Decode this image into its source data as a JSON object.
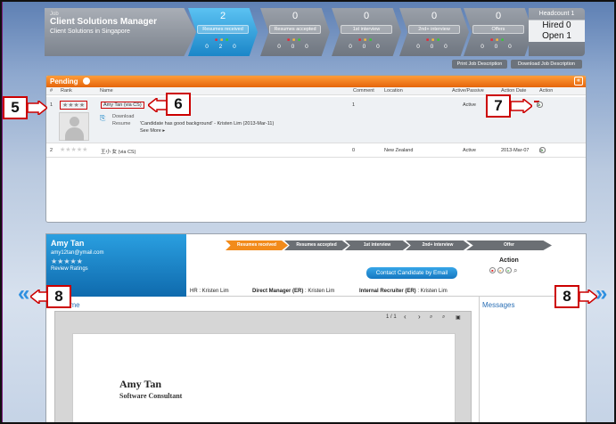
{
  "job": {
    "label": "Job",
    "title": "Client Solutions Manager",
    "subtitle": "Client Solutions in Singapore"
  },
  "stages": [
    {
      "count": "2",
      "label": "Resumes received",
      "counts": "0 2 0"
    },
    {
      "count": "0",
      "label": "Resumes accepted",
      "counts": "0 0 0"
    },
    {
      "count": "0",
      "label": "1st interview",
      "counts": "0 0 0"
    },
    {
      "count": "0",
      "label": "2nd+ interview",
      "counts": "0 0 0"
    },
    {
      "count": "0",
      "label": "Offers",
      "counts": "0 0 0"
    }
  ],
  "headcount": {
    "label": "Headcount 1",
    "hired": "Hired 0",
    "open": "Open 1"
  },
  "buttons": {
    "print_jd": "Print Job Description",
    "download_jd": "Download Job Description"
  },
  "pending": {
    "title": "Pending",
    "collapse": "«",
    "columns": {
      "num": "#",
      "rank": "Rank",
      "name": "Name",
      "comment": "Comment",
      "location": "Location",
      "status": "Active/Passive",
      "date": "Action Date",
      "action": "Action"
    },
    "rows": [
      {
        "num": "1",
        "stars": "★★★★",
        "name": "Amy Tan (via CS)",
        "comment": "1",
        "location": "",
        "status": "Active",
        "date": ""
      },
      {
        "num": "2",
        "stars": "★★★★★",
        "name": "王小 女 (via CS)",
        "comment": "0",
        "location": "New Zealand",
        "status": "Active",
        "date": "2013-Mar-07"
      }
    ],
    "download": "Download",
    "resume": "Resume",
    "quote": "'Candidate has good background' - Kristen Lim (2013-Mar-11)",
    "see_more": "See More ▸"
  },
  "candidate": {
    "name": "Amy Tan",
    "email": "amy12tan@ymail.com",
    "stars": "★★★★★",
    "review": "Review Ratings",
    "pipeline": [
      "Resumes received",
      "Resumes accepted",
      "1st interview",
      "2nd+ interview",
      "Offer"
    ],
    "contact_btn": "Contact Candidate by Email",
    "action_label": "Action",
    "people": {
      "hr": "HR : Kristen Lim",
      "dm_label": "Direct Manager (ER)",
      "dm": " : Kristen Lim",
      "ir_label": "Internal Recruiter (ER)",
      "ir": " : Kristen Lim"
    },
    "resume_heading": "ume",
    "viewer": {
      "page": "1 / 1",
      "prev": "‹",
      "next": "›"
    },
    "paper_name": "Amy Tan",
    "paper_title": "Software Consultant",
    "messages": "Messages"
  },
  "callouts": {
    "c5": "5",
    "c6": "6",
    "c7": "7",
    "c8a": "8",
    "c8b": "8"
  },
  "colors": {
    "accent": "#f28b1b",
    "blue": "#1b86c8",
    "callout": "#cc0000"
  }
}
